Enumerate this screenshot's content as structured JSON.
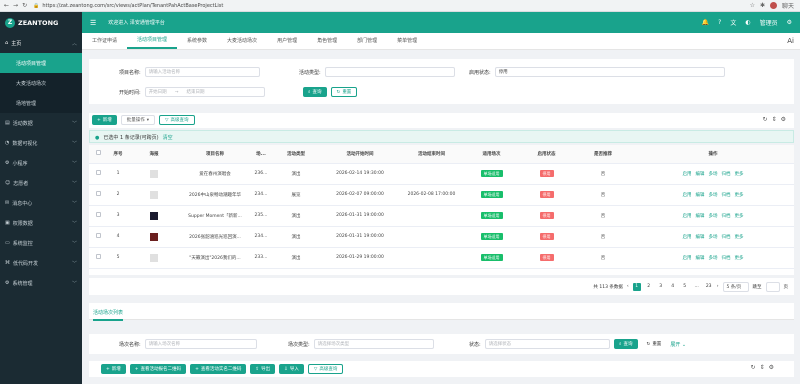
{
  "browser": {
    "url": "https://zat.zeantong.com/src/views/actPlan/TenantPahActBaseProjectList",
    "chat_label": "聊天"
  },
  "app": {
    "logo": "ZEANTONG",
    "welcome": "欢迎进入 泽安通管理平台",
    "user": "管理员"
  },
  "sidebar": {
    "home": "主页",
    "sub": [
      "活动项目管理",
      "大麦活动场次",
      "场地管理"
    ],
    "items": [
      "活动数据",
      "数据可视化",
      "小程序",
      "志愿者",
      "消息中心",
      "权限数据",
      "系统监控",
      "低代码开发",
      "系统管理"
    ]
  },
  "tabs": [
    "工作证申请",
    "活动项目管理",
    "系统参数",
    "大麦活动场次",
    "用户管理",
    "角色管理",
    "部门管理",
    "菜单管理"
  ],
  "search": {
    "name_label": "项目名称:",
    "name_ph": "请输入活动名称",
    "type_label": "活动类型:",
    "status_label": "启用状态:",
    "status_value": "停用",
    "start_label": "开始时间:",
    "start_ph": "开始日期",
    "end_ph": "结束日期",
    "search_btn": "查询",
    "reset_btn": "重置"
  },
  "toolbar": {
    "add": "新增",
    "batch": "批量操作",
    "advanced": "高级查询"
  },
  "selinfo": {
    "text": "已选中 1 条记录(可跨页)",
    "clear": "清空"
  },
  "table": {
    "headers": [
      "序号",
      "海报",
      "项目名称",
      "场...",
      "活动类型",
      "活动开始时间",
      "活动结束时间",
      "适用场次",
      "启用状态",
      "是否推荐",
      "操作"
    ],
    "rows": [
      {
        "no": "1",
        "name": "爱在春州演唱会",
        "venue": "236...",
        "type": "演出",
        "start": "2026-02-14 19:30:00",
        "end": "",
        "scope": "单场适用",
        "status": "停用",
        "rec": "否"
      },
      {
        "no": "2",
        "name": "2026中山泉畅动潮趣年华",
        "venue": "234...",
        "type": "展览",
        "start": "2026-02-07 09:00:00",
        "end": "2026-02-08 17:00:00",
        "scope": "单场适用",
        "status": "停用",
        "rec": "否"
      },
      {
        "no": "3",
        "name": "Supper Moment「新新...",
        "venue": "235...",
        "type": "演出",
        "start": "2026-01-31 19:00:00",
        "end": "",
        "scope": "单场适用",
        "status": "停用",
        "rec": "否"
      },
      {
        "no": "4",
        "name": "2026张韶涵巡光巡回演...",
        "venue": "234...",
        "type": "演出",
        "start": "2026-01-31 19:00:00",
        "end": "",
        "scope": "单场适用",
        "status": "停用",
        "rec": "否"
      },
      {
        "no": "5",
        "name": "\"天籁演出\"2026我们的...",
        "venue": "233...",
        "type": "演出",
        "start": "2026-01-29 19:00:00",
        "end": "",
        "scope": "单场适用",
        "status": "停用",
        "rec": "否"
      }
    ],
    "ops": [
      "启用",
      "编辑",
      "多场",
      "归档",
      "更多"
    ]
  },
  "pager": {
    "total": "共 113 条数据",
    "pages": [
      "1",
      "2",
      "3",
      "4",
      "5",
      "...",
      "23"
    ],
    "size": "5 条/页",
    "jump": "跳至",
    "page_unit": "页"
  },
  "section2": {
    "title": "活动场次列表",
    "name_label": "场次名称:",
    "name_ph": "请输入场次名称",
    "type_label": "场次类型:",
    "type_ph": "请选择场次类型",
    "status_label": "状态:",
    "status_ph": "请选择状态",
    "search_btn": "查询",
    "reset_btn": "重置",
    "expand": "展开",
    "buttons": [
      "新增",
      "查看活动报名二维码",
      "查看活动实名二维码",
      "导出",
      "导入",
      "高级查询"
    ]
  }
}
